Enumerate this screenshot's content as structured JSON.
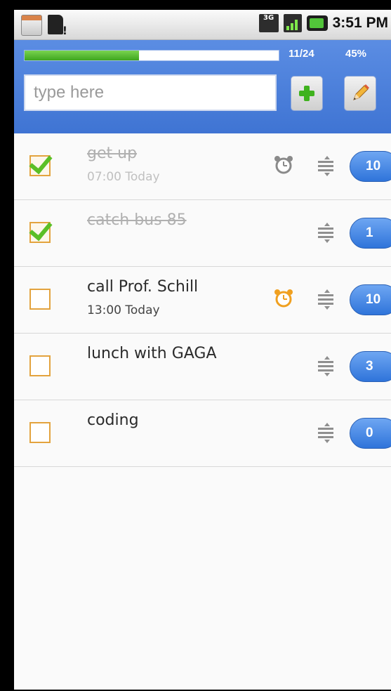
{
  "status_bar": {
    "time": "3:51 PM",
    "network": "3G",
    "icons": [
      "calendar-icon",
      "sd-card-icon",
      "3g-icon",
      "signal-icon",
      "battery-charging-icon"
    ]
  },
  "header": {
    "progress": {
      "count": "11/24",
      "percent": "45%",
      "fraction": 0.45
    },
    "input_placeholder": "type here",
    "input_value": "",
    "add_icon": "plus-icon",
    "edit_icon": "pencil-icon"
  },
  "tasks": [
    {
      "title": "get up",
      "subtitle": "07:00  Today",
      "done": true,
      "alarm": "grey",
      "count": "10"
    },
    {
      "title": "catch bus 85",
      "subtitle": "",
      "done": true,
      "alarm": null,
      "count": "1"
    },
    {
      "title": "call Prof. Schill",
      "subtitle": "13:00  Today",
      "done": false,
      "alarm": "orange",
      "count": "10"
    },
    {
      "title": "lunch with GAGA",
      "subtitle": "",
      "done": false,
      "alarm": null,
      "count": "3"
    },
    {
      "title": "coding",
      "subtitle": "",
      "done": false,
      "alarm": null,
      "count": "0"
    }
  ],
  "colors": {
    "header_blue": "#4a7fd9",
    "progress_green": "#4fb82c",
    "checkbox_orange": "#e3a33e",
    "check_green": "#5bbf26",
    "badge_blue": "#2f74da",
    "alarm_orange": "#f0a020"
  }
}
